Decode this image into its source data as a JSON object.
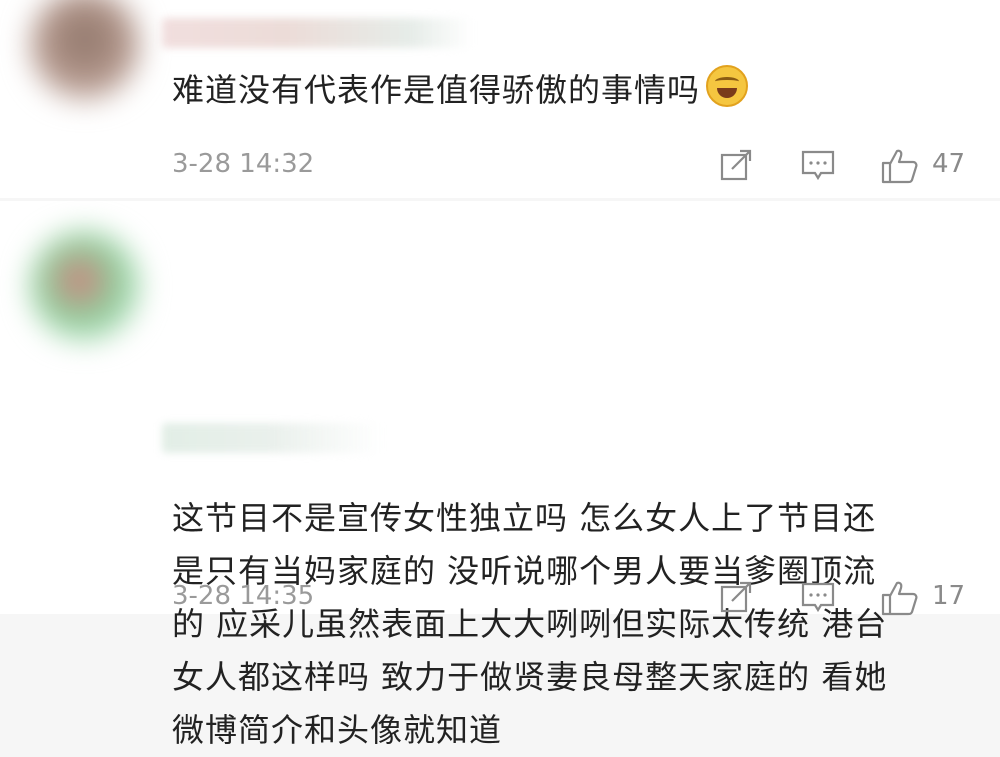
{
  "comments": [
    {
      "text": "难道没有代表作是值得骄傲的事情吗",
      "time": "3-28 14:32",
      "likes": "47",
      "icons": [
        "share-icon",
        "reply-icon",
        "like-icon"
      ]
    },
    {
      "lines": [
        "这节目不是宣传女性独立吗 怎么女人上了节目还",
        "是只有当妈家庭的 没听说哪个男人要当爹圈顶流",
        "的 应采儿虽然表面上大大咧咧但实际太传统 港台",
        "女人都这样吗 致力于做贤妻良母整天家庭的 看她",
        "微博简介和头像就知道"
      ],
      "time": "3-28 14:35",
      "likes": "17",
      "icons": [
        "share-icon",
        "reply-icon",
        "like-icon"
      ]
    }
  ]
}
